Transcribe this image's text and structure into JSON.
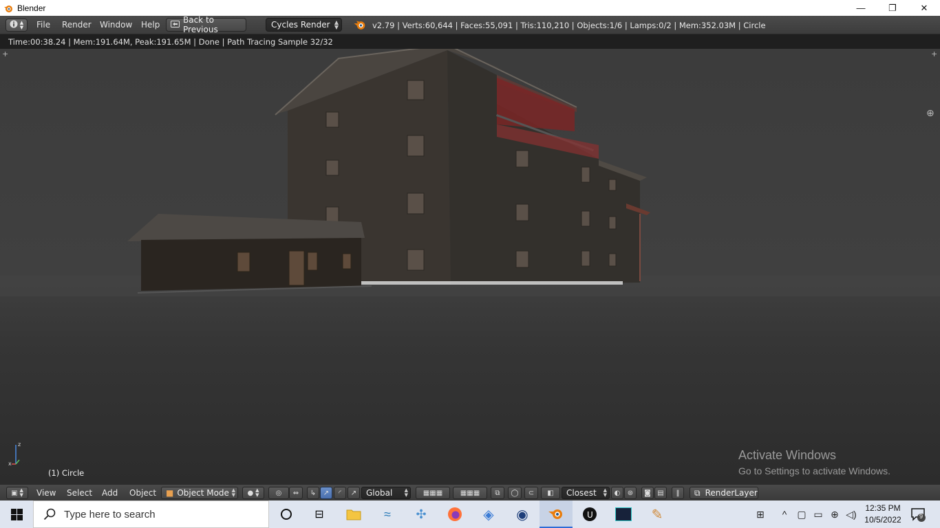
{
  "window": {
    "title": "Blender",
    "minimize_glyph": "—",
    "restore_glyph": "❐",
    "close_glyph": "✕"
  },
  "info_header": {
    "editor_type_icon": "info-icon",
    "menus": [
      "File",
      "Render",
      "Window",
      "Help"
    ],
    "back_button_label": "Back to Previous",
    "render_engine": "Cycles Render",
    "stats": "v2.79 | Verts:60,644 | Faces:55,091 | Tris:110,210 | Objects:1/6 | Lamps:0/2 | Mem:352.03M | Circle"
  },
  "render_status": "Time:00:38.24 | Mem:191.64M, Peak:191.65M | Done | Path Tracing Sample 32/32",
  "viewport": {
    "object_label": "(1) Circle",
    "axis_x": "x",
    "axis_z": "z",
    "watermark_title": "Activate Windows",
    "watermark_sub": "Go to Settings to activate Windows."
  },
  "view3d_header": {
    "menus": [
      "View",
      "Select",
      "Add",
      "Object"
    ],
    "mode": "Object Mode",
    "transform_orientation": "Global",
    "snap_target": "Closest",
    "render_layer": "RenderLayer"
  },
  "taskbar": {
    "search_placeholder": "Type here to search",
    "time": "12:35 PM",
    "date": "10/5/2022",
    "notification_count": "9"
  },
  "colors": {
    "blender_orange": "#e87d0d",
    "header_bg": "#444444",
    "viewport_bg": "#3b3b3b",
    "taskbar_bg": "#dfe5f0"
  }
}
